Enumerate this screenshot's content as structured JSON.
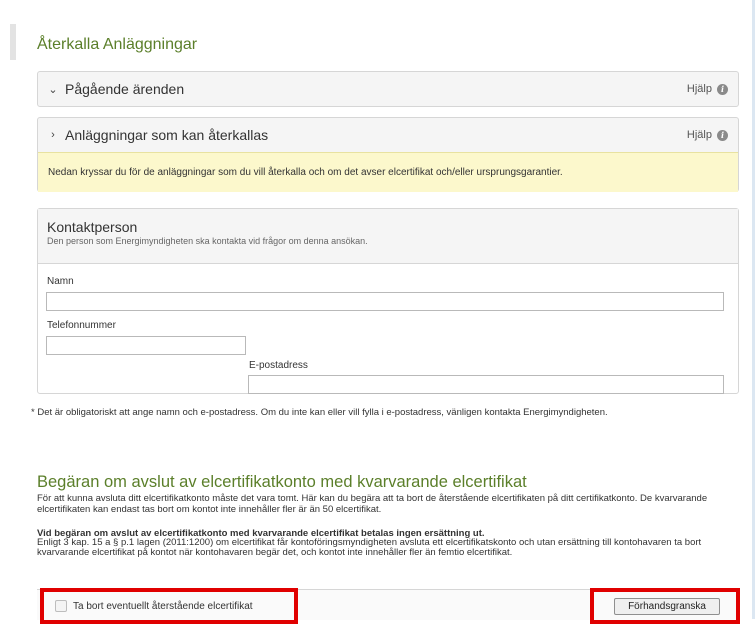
{
  "page": {
    "title": "Återkalla Anläggningar"
  },
  "panels": [
    {
      "chevron": "chevron-down-icon",
      "glyph": "⌄",
      "title": "Pågående ärenden",
      "help": "Hjälp"
    },
    {
      "chevron": "chevron-right-icon",
      "glyph": "›",
      "title": "Anläggningar som kan återkallas",
      "help": "Hjälp"
    }
  ],
  "notice": "Nedan kryssar du för de anläggningar som du vill återkalla och om det avser elcertifikat och/eller ursprungsgarantier.",
  "contact": {
    "title": "Kontaktperson",
    "subtitle": "Den person som Energimyndigheten ska kontakta vid frågor om denna ansökan.",
    "name_label": "Namn",
    "name_value": "",
    "phone_label": "Telefonnummer",
    "phone_value": "",
    "email_label": "E-postadress",
    "email_value": ""
  },
  "footnote": "* Det är obligatoriskt att ange namn och e-postadress. Om du inte kan eller vill fylla i e-postadress, vänligen kontakta Energimyndigheten.",
  "request": {
    "title": "Begäran om avslut av elcertifikatkonto med kvarvarande elcertifikat",
    "para1": "För att kunna avsluta ditt elcertifikatkonto måste det vara tomt. Här kan du begära att ta bort de återstående elcertifikaten på ditt certifikatkonto. De kvarvarande elcertifikaten kan endast tas bort om kontot inte innehåller fler är än 50 elcertifikat.",
    "bold": "Vid begäran om avslut av elcertifikatkonto med kvarvarande elcertifikat betalas ingen ersättning ut.",
    "para2": "Enligt 3 kap. 15 a § p.1 lagen (2011:1200) om elcertifikat får kontoföringsmyndigheten avsluta ett elcertifikatskonto och utan ersättning till kontohavaren ta bort kvarvarande elcertifikat på kontot när kontohavaren begär det, och kontot inte innehåller fler än femtio elcertifikat.",
    "checkbox_label": "Ta bort eventuellt återstående elcertifikat",
    "checkbox_checked": false,
    "preview_button": "Förhandsgranska"
  },
  "colors": {
    "heading": "#5b7f2a",
    "highlight": "#e00000",
    "notice_bg": "#fcf8cc"
  }
}
